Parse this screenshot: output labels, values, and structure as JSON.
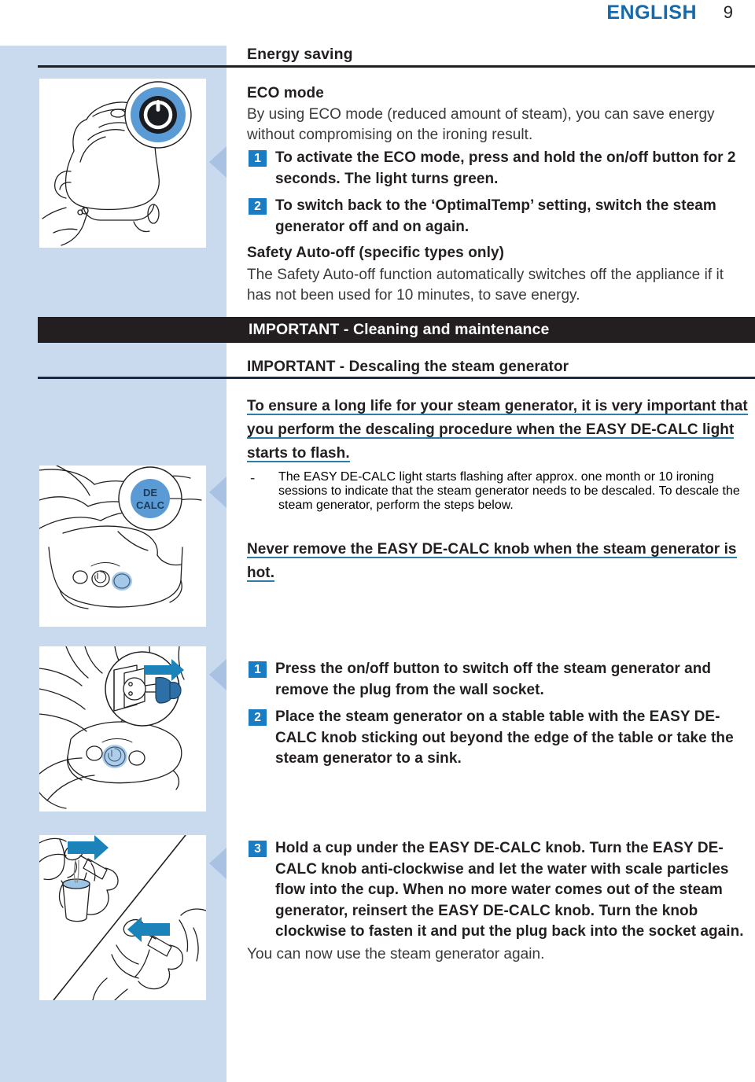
{
  "header": {
    "language": "ENGLISH",
    "page_number": "9"
  },
  "sections": {
    "energy_saving": {
      "title": "Energy saving",
      "eco": {
        "heading": "ECO mode",
        "body": "By using ECO mode (reduced amount of steam), you can save energy without compromising on the ironing result.",
        "steps": [
          {
            "num": "1",
            "text": "To activate the ECO mode, press and hold the on/off button for 2 seconds. The light turns green."
          },
          {
            "num": "2",
            "text": "To switch back to the ‘OptimalTemp’ setting, switch the steam generator off and on again."
          }
        ]
      },
      "safety": {
        "heading": "Safety Auto-off (specific types only)",
        "body": "The Safety Auto-off function automatically switches off the appliance if it has not been used for 10 minutes, to save energy."
      }
    },
    "important_banner": "IMPORTANT - Cleaning and maintenance",
    "descaling": {
      "heading": "IMPORTANT - Descaling the steam generator",
      "highlight": "To ensure a long life for your steam generator, it is very important that you perform the descaling procedure when the EASY DE-CALC light starts to flash.",
      "bullet_mark": "-",
      "bullet": "The EASY DE-CALC light starts flashing after approx. one month or 10 ironing sessions to indicate that the steam generator needs to be descaled. To descale the steam generator, perform the steps below.",
      "warning": "Never remove the EASY DE-CALC knob when the steam generator is hot.",
      "steps": [
        {
          "num": "1",
          "text": "Press the on/off button to switch off the steam generator and remove the plug from the wall socket."
        },
        {
          "num": "2",
          "text": "Place the steam generator on a stable table with the EASY DE-CALC knob sticking out beyond the edge of the table or take the steam generator to a sink."
        },
        {
          "num": "3",
          "text": "Hold a cup under the EASY DE-CALC knob. Turn the EASY DE-CALC knob anti-clockwise and let the water with scale particles flow into the cup. When no more water comes out of the steam generator, reinsert the EASY DE-CALC knob. Turn the knob clockwise to fasten it and put the plug back into the socket again."
        }
      ],
      "closing": "You can now use the steam generator again."
    }
  },
  "illustrations": [
    {
      "name": "steam-generator-power-button",
      "callout_label": "power-symbol"
    },
    {
      "name": "steam-generator-de-calc-knob",
      "callout_label": "DE CALC"
    },
    {
      "name": "unplug-from-wall-socket",
      "callout_label": "plug-and-socket"
    },
    {
      "name": "drain-water-into-cup",
      "callout_label": "knob-turn-arrows"
    }
  ],
  "colors": {
    "accent_blue": "#1a7dc4",
    "header_blue": "#1669ab",
    "panel_blue": "#c9d9ee",
    "illustration_blue": "#5b9bd5",
    "underline_teal": "#2f7ea8",
    "banner_black": "#231f20"
  }
}
